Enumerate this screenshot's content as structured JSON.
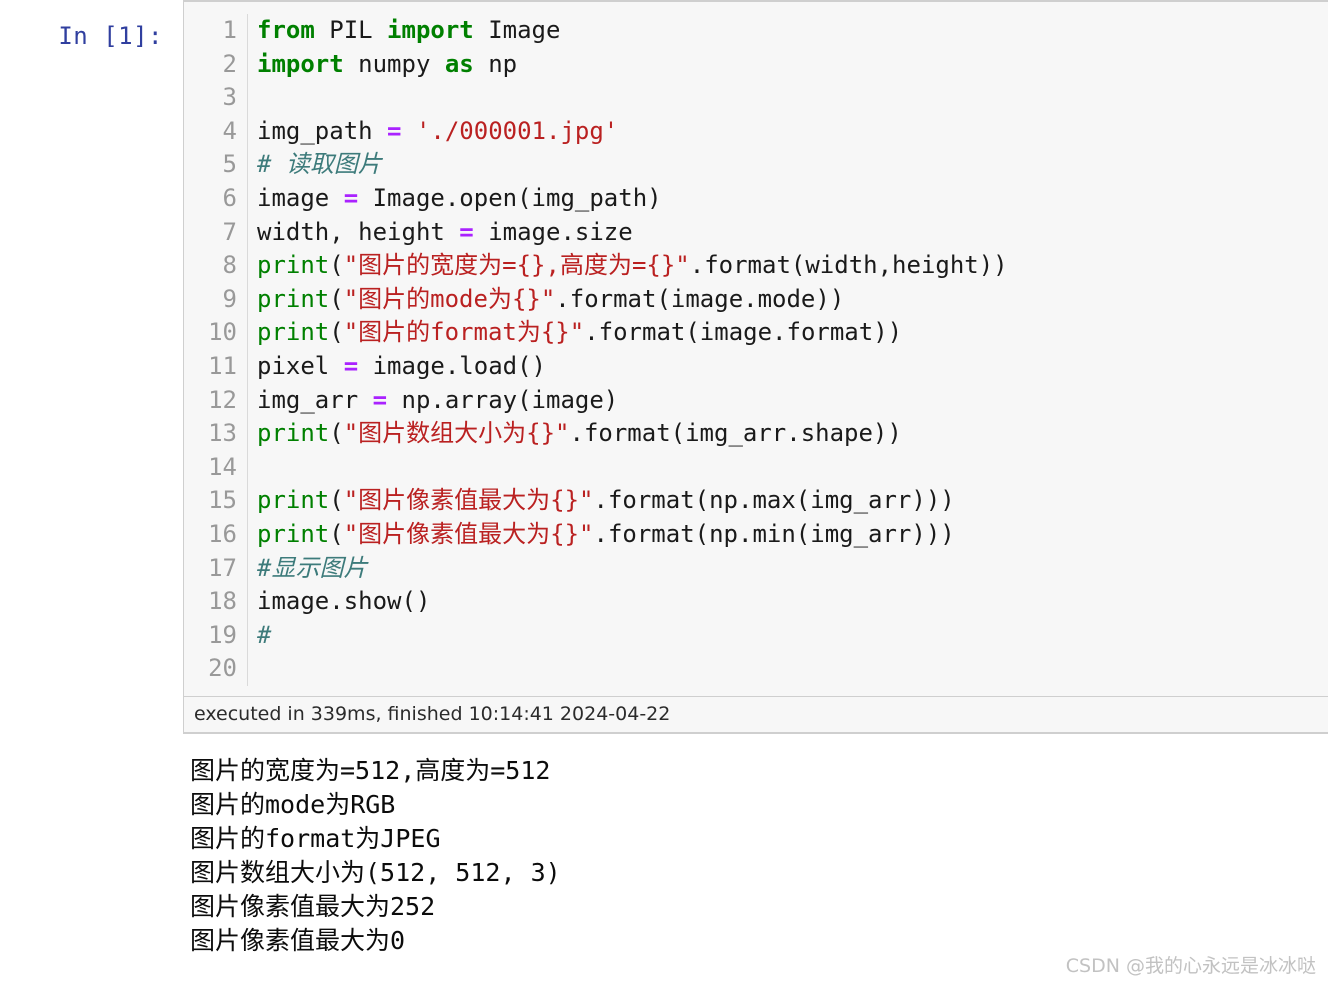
{
  "cell": {
    "prompt": "In [1]:",
    "line_numbers": [
      "1",
      "2",
      "3",
      "4",
      "5",
      "6",
      "7",
      "8",
      "9",
      "10",
      "11",
      "12",
      "13",
      "14",
      "15",
      "16",
      "17",
      "18",
      "19",
      "20"
    ],
    "code_lines": [
      {
        "n": "1",
        "tokens": [
          {
            "t": "from",
            "c": "kw"
          },
          {
            "t": " PIL ",
            "c": "pln"
          },
          {
            "t": "import",
            "c": "kw"
          },
          {
            "t": " Image",
            "c": "pln"
          }
        ]
      },
      {
        "n": "2",
        "tokens": [
          {
            "t": "import",
            "c": "kw"
          },
          {
            "t": " numpy ",
            "c": "pln"
          },
          {
            "t": "as",
            "c": "kw"
          },
          {
            "t": " np",
            "c": "pln"
          }
        ]
      },
      {
        "n": "3",
        "tokens": []
      },
      {
        "n": "4",
        "tokens": [
          {
            "t": "img_path ",
            "c": "pln"
          },
          {
            "t": "=",
            "c": "op"
          },
          {
            "t": " ",
            "c": "pln"
          },
          {
            "t": "'./000001.jpg'",
            "c": "str"
          }
        ]
      },
      {
        "n": "5",
        "tokens": [
          {
            "t": "# 读取图片",
            "c": "cmt"
          }
        ]
      },
      {
        "n": "6",
        "tokens": [
          {
            "t": "image ",
            "c": "pln"
          },
          {
            "t": "=",
            "c": "op"
          },
          {
            "t": " Image.open(img_path)",
            "c": "pln"
          }
        ]
      },
      {
        "n": "7",
        "tokens": [
          {
            "t": "width, height ",
            "c": "pln"
          },
          {
            "t": "=",
            "c": "op"
          },
          {
            "t": " image.size",
            "c": "pln"
          }
        ]
      },
      {
        "n": "8",
        "tokens": [
          {
            "t": "print",
            "c": "bi"
          },
          {
            "t": "(",
            "c": "pln"
          },
          {
            "t": "\"图片的宽度为={},高度为={}\"",
            "c": "str"
          },
          {
            "t": ".format(width,height))",
            "c": "pln"
          }
        ]
      },
      {
        "n": "9",
        "tokens": [
          {
            "t": "print",
            "c": "bi"
          },
          {
            "t": "(",
            "c": "pln"
          },
          {
            "t": "\"图片的mode为{}\"",
            "c": "str"
          },
          {
            "t": ".format(image.mode))",
            "c": "pln"
          }
        ]
      },
      {
        "n": "10",
        "tokens": [
          {
            "t": "print",
            "c": "bi"
          },
          {
            "t": "(",
            "c": "pln"
          },
          {
            "t": "\"图片的format为{}\"",
            "c": "str"
          },
          {
            "t": ".format(image.format))",
            "c": "pln"
          }
        ]
      },
      {
        "n": "11",
        "tokens": [
          {
            "t": "pixel ",
            "c": "pln"
          },
          {
            "t": "=",
            "c": "op"
          },
          {
            "t": " image.load()",
            "c": "pln"
          }
        ]
      },
      {
        "n": "12",
        "tokens": [
          {
            "t": "img_arr ",
            "c": "pln"
          },
          {
            "t": "=",
            "c": "op"
          },
          {
            "t": " np.array(image)",
            "c": "pln"
          }
        ]
      },
      {
        "n": "13",
        "tokens": [
          {
            "t": "print",
            "c": "bi"
          },
          {
            "t": "(",
            "c": "pln"
          },
          {
            "t": "\"图片数组大小为{}\"",
            "c": "str"
          },
          {
            "t": ".format(img_arr.shape))",
            "c": "pln"
          }
        ]
      },
      {
        "n": "14",
        "tokens": []
      },
      {
        "n": "15",
        "tokens": [
          {
            "t": "print",
            "c": "bi"
          },
          {
            "t": "(",
            "c": "pln"
          },
          {
            "t": "\"图片像素值最大为{}\"",
            "c": "str"
          },
          {
            "t": ".format(np.max(img_arr)))",
            "c": "pln"
          }
        ]
      },
      {
        "n": "16",
        "tokens": [
          {
            "t": "print",
            "c": "bi"
          },
          {
            "t": "(",
            "c": "pln"
          },
          {
            "t": "\"图片像素值最大为{}\"",
            "c": "str"
          },
          {
            "t": ".format(np.min(img_arr)))",
            "c": "pln"
          }
        ]
      },
      {
        "n": "17",
        "tokens": [
          {
            "t": "#显示图片",
            "c": "cmt"
          }
        ]
      },
      {
        "n": "18",
        "tokens": [
          {
            "t": "image.show()",
            "c": "pln"
          }
        ]
      },
      {
        "n": "19",
        "tokens": [
          {
            "t": "#",
            "c": "cmt"
          }
        ]
      },
      {
        "n": "20",
        "tokens": []
      }
    ],
    "exec_info": "executed in 339ms, finished 10:14:41 2024-04-22"
  },
  "output": {
    "lines": [
      "图片的宽度为=512,高度为=512",
      "图片的mode为RGB",
      "图片的format为JPEG",
      "图片数组大小为(512, 512, 3)",
      "图片像素值最大为252",
      "图片像素值最大为0"
    ]
  },
  "watermark": {
    "text": "CSDN @我的心永远是冰冰哒"
  },
  "colors": {
    "prompt": "#303F9F",
    "keyword": "#008000",
    "string": "#BA2121",
    "operator": "#AA22FF",
    "comment": "#3D7B7B",
    "cell_background": "#f7f7f7",
    "gutter_text": "#999999"
  }
}
